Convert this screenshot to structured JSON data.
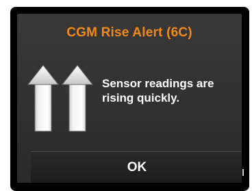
{
  "alert": {
    "title": "CGM Rise Alert (6C)",
    "message_line1": "Sensor readings are",
    "message_line2": "rising quickly.",
    "icon": "double-up-arrow-icon",
    "title_color": "#f08a1a"
  },
  "actions": {
    "ok_label": "OK"
  }
}
